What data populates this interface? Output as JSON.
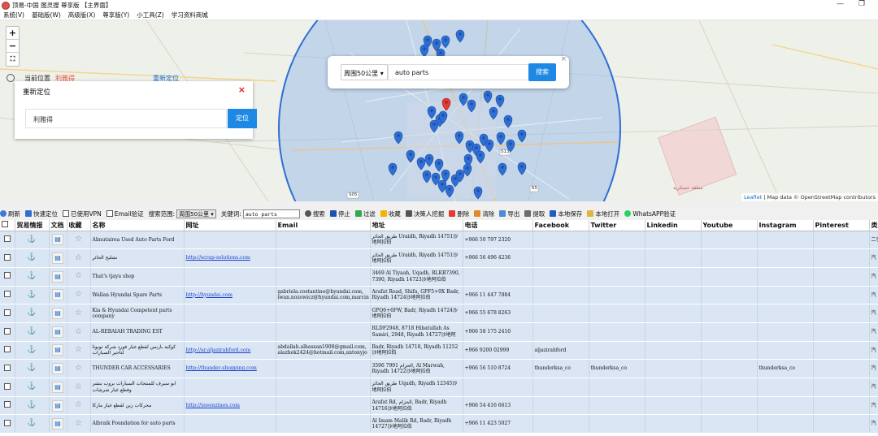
{
  "window": {
    "title": "顶易-中国 图灵搜 尊享版 【主界面】",
    "minimize": "—",
    "maximize": "❐"
  },
  "menu": [
    "系统(V)",
    "基础版(W)",
    "高级版(X)",
    "尊享版(Y)",
    "小工具(Z)",
    "学习资料商城"
  ],
  "map": {
    "zoom_in": "+",
    "zoom_out": "−",
    "fullscreen": "⛶",
    "current_location_label": "当前位置",
    "current_location_value": "利雅得",
    "relocate_link": "重新定位",
    "relocate_dialog": {
      "title": "重新定位",
      "close": "×",
      "input_value": "利雅得",
      "button": "定位"
    },
    "search": {
      "radius": "周围50公里",
      "keyword": "auto parts",
      "button": "搜索",
      "close": "×"
    },
    "labels": [
      "مطقة عسكرية",
      "S13",
      "S05",
      "65"
    ],
    "attribution_leaflet": "Leaflet",
    "attribution_rest": " | Map data © OpenStreetMap contributors"
  },
  "toolbar": {
    "refresh": "刷新",
    "quick_locate": "快速定位",
    "use_vpn": "已使用VPN",
    "email_verify": "Email验证",
    "search_range_label": "搜索范围:",
    "search_range_value": "周围50公里",
    "keyword_label": "关键词:",
    "keyword_value": "auto parts",
    "search": "搜索",
    "stop": "停止",
    "filter": "过滤",
    "favorite": "收藏",
    "decision_maker": "决策人挖掘",
    "delete": "删除",
    "clear": "清除",
    "export": "导出",
    "extract": "提取",
    "save_local": "本地保存",
    "open_local": "本地打开",
    "whatsapp": "WhatsAPP验证"
  },
  "table": {
    "headers": [
      "",
      "贸易情报",
      "文档",
      "收藏",
      "名称",
      "网址",
      "Email",
      "地址",
      "电话",
      "Facebook",
      "Twitter",
      "Linkedin",
      "Youtube",
      "Instagram",
      "Pinterest",
      "类"
    ],
    "rows": [
      {
        "name": "Almutairea Used Auto Parts Ford",
        "url": "",
        "email": "",
        "address": "طريق الحائر Uraidh, Riyadh 14751沙地阿拉伯",
        "phone": "+966 50 797 2320",
        "facebook": "",
        "twitter": "",
        "instagram": "",
        "type": "二手"
      },
      {
        "name": "تشليح الحائر",
        "url": "http://scrap-solutions.com",
        "email": "",
        "address": "طريق الحائر Uraidh, Riyadh 14751沙地阿拉伯",
        "phone": "+966 56 496 4236",
        "facebook": "",
        "twitter": "",
        "instagram": "",
        "type": "汽"
      },
      {
        "name": "That's tjayu shop",
        "url": "",
        "email": "",
        "address": "3469 Al Tiyaah, Uqadh, RLKB7390, 7390, Riyadh 14723沙地阿拉伯",
        "phone": "",
        "facebook": "",
        "twitter": "",
        "instagram": "",
        "type": "汽"
      },
      {
        "name": "Wallan Hyundai Spare Parts",
        "url": "http://hyundai.com",
        "email": "gabriela.costantino@hyundai.com, iwan.nozowicz@hyundai.com,marcin",
        "address": "Arafat Road, Shifa, GPF5+9X Badr, Riyadh 14724沙地阿拉伯",
        "phone": "+966 11 447 7884",
        "facebook": "",
        "twitter": "",
        "instagram": "",
        "type": "汽"
      },
      {
        "name": "Kia & Hyundai Competent parts company",
        "url": "",
        "email": "",
        "address": "GPQ6+6FW, Badr, Riyadh 14724沙地阿拉伯",
        "phone": "+966 55 678 8263",
        "facebook": "",
        "twitter": "",
        "instagram": "",
        "type": "汽"
      },
      {
        "name": "AL-REBAIAH TRADING EST",
        "url": "",
        "email": "",
        "address": "RLDF2948, 8718 Hibatullah As Samiri, 2948, Riyadh 14727沙地阿",
        "phone": "+966 58 175 2410",
        "facebook": "",
        "twitter": "",
        "instagram": "",
        "type": "汽"
      },
      {
        "name": "كوكبة بارنس لقطع غيار فورد شركة تويوتا لتأجير السيارات",
        "url": "http://ar.aljazirahford.com",
        "email": "abdallah.alhassan1908@gmail.com, alazhek2424@hotmail.com,antonyjo",
        "address": "Badr, Riyadh 14718, Riyadh 11252沙地阿拉伯",
        "phone": "+966 9200 02999",
        "facebook": "aljazirahford",
        "twitter": "",
        "instagram": "",
        "type": "汽"
      },
      {
        "name": "THUNDER CAR ACCESSARIES",
        "url": "http://thunder-shopping.com",
        "email": "",
        "address": "3596 7991 الحزام, Al Marwah, Riyadh 14722沙地阿拉伯",
        "phone": "+966 56 510 8724",
        "facebook": "thunderksa_co",
        "twitter": "thunderksa_co",
        "instagram": "thunderksa_co",
        "type": "汽"
      },
      {
        "name": "ابو سيرف للمنتجات السيارات بروت بنشر وقطع غيار شرشات",
        "url": "",
        "email": "",
        "address": "طريق الحائر Uqadh, Riyadh 12345沙地阿拉伯",
        "phone": "",
        "facebook": "",
        "twitter": "",
        "instagram": "",
        "type": "汽"
      },
      {
        "name": "محركات زين لقطع غيار ماركا",
        "url": "http://zeeenzines.com",
        "email": "",
        "address": "Arafat Rd, الحزام, Badr, Riyadh 14716沙地阿拉伯",
        "phone": "+966 54 416 6613",
        "facebook": "",
        "twitter": "",
        "instagram": "",
        "type": "汽"
      },
      {
        "name": "Albraik Foundation for auto parts",
        "url": "",
        "email": "",
        "address": "Al Imam Malik Rd, Badr, Riyadh 14727沙地阿拉伯",
        "phone": "+966 11 423 5027",
        "facebook": "",
        "twitter": "",
        "instagram": "",
        "type": "汽"
      }
    ]
  }
}
